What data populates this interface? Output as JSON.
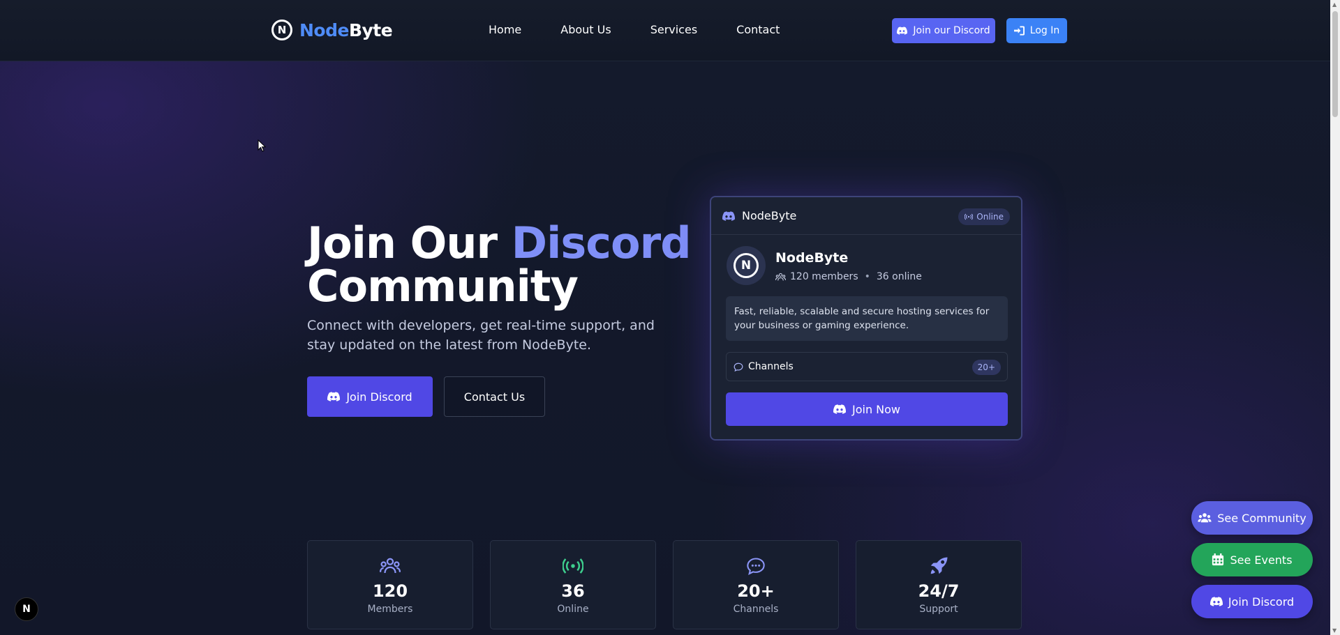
{
  "nav": {
    "brand_part1": "Node",
    "brand_part2": "Byte",
    "links": [
      "Home",
      "About Us",
      "Services",
      "Contact"
    ],
    "discord_button": "Join our Discord",
    "login_button": "Log In"
  },
  "hero": {
    "title_part1": "Join Our ",
    "title_accent": "Discord",
    "title_part2": "Community",
    "subtitle": "Connect with developers, get real-time support, and stay updated on the latest from NodeByte.",
    "join_button": "Join Discord",
    "contact_button": "Contact Us"
  },
  "card": {
    "header_title": "NodeByte",
    "status": "Online",
    "server_name": "NodeByte",
    "members": "120 members",
    "online": "36 online",
    "description": "Fast, reliable, scalable and secure hosting services for your business or gaming experience.",
    "channels_label": "Channels",
    "channels_count": "20+",
    "join_button": "Join Now"
  },
  "stats": [
    {
      "icon": "users-icon",
      "value": "120",
      "label": "Members"
    },
    {
      "icon": "broadcast-icon",
      "value": "36",
      "label": "Online"
    },
    {
      "icon": "chat-icon",
      "value": "20+",
      "label": "Channels"
    },
    {
      "icon": "rocket-icon",
      "value": "24/7",
      "label": "Support"
    }
  ],
  "floating": {
    "community": "See Community",
    "events": "See Events",
    "discord": "Join Discord"
  },
  "next_badge": "N",
  "colors": {
    "accent": "#5048e5",
    "discord": "#5865f2",
    "login": "#3b82f6",
    "events": "#23a55a",
    "brand_blue": "#4f8cf7"
  }
}
